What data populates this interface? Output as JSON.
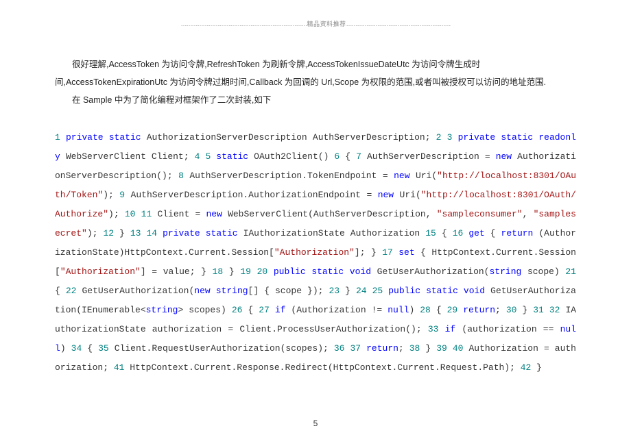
{
  "header": {
    "text": "精品资料推荐"
  },
  "paragraphs": {
    "p1": "很好理解,AccessToken 为访问令牌,RefreshToken 为刷新令牌,AccessTokenIssueDateUtc 为访问令牌生成时间,AccessTokenExpirationUtc 为访问令牌过期时间,Callback 为回调的 Url,Scope 为权限的范围,或者叫被授权可以访问的地址范围.",
    "p2": "在 Sample 中为了简化编程对框架作了二次封装,如下"
  },
  "page_number": "5",
  "code": {
    "n1": "1",
    "kw_private1": "private",
    "kw_static1": "static",
    "pl1": " AuthorizationServerDescription AuthServerDescription; ",
    "n2": "2",
    "n3": "3",
    "kw_private2": "private",
    "kw_static2": "static",
    "kw_readonly": "readonly",
    "pl2": " WebServerClient Client; ",
    "n4": "4",
    "n5": "5",
    "kw_static3": "static",
    "pl3": " OAuth2Client() ",
    "n6": "6",
    "pl4": " { ",
    "n7": "7",
    "pl5": " AuthServerDescription = ",
    "kw_new1": "new",
    "pl6": " AuthorizationServerDescription(); ",
    "n8": "8",
    "pl7": " AuthServerDescription.TokenEndpoint = ",
    "kw_new2": "new",
    "pl8": " Uri(",
    "str1": "\"http://localhost:8301/OAuth/Token\"",
    "pl9": "); ",
    "n9": "9",
    "pl10": " AuthServerDescription.AuthorizationEndpoint = ",
    "kw_new3": "new",
    "pl11": " Uri(",
    "str2": "\"http://localhost:8301/OAuth/Authorize\"",
    "pl12": "); ",
    "n10": "10",
    "n11": "11",
    "pl13": " Client = ",
    "kw_new4": "new",
    "pl14": " WebServerClient(AuthServerDescription, ",
    "str3": "\"sampleconsumer\"",
    "pl15": ", ",
    "str4": "\"samplesecret\"",
    "pl16": "); ",
    "n12": "12",
    "pl17": " } ",
    "n13": "13",
    "n14": "14",
    "kw_private3": "private",
    "kw_static4": "static",
    "pl18": " IAuthorizationState Authorization ",
    "n15": "15",
    "pl19": " { ",
    "n16": "16",
    "kw_get": "get",
    "pl20": " { ",
    "kw_return1": "return",
    "pl21": " (AuthorizationState)HttpContext.Current.Session[",
    "str5": "\"Authorization\"",
    "pl22": "]; } ",
    "n17": "17",
    "kw_set": "set",
    "pl23": " { HttpContext.Current.Session[",
    "str6": "\"Authorization\"",
    "pl24": "] = value; } ",
    "n18": "18",
    "pl25": " } ",
    "n19": "19",
    "n20": "20",
    "kw_public1": "public",
    "kw_static5": "static",
    "kw_void1": "void",
    "pl26": " GetUserAuthorization(",
    "kw_string1": "string",
    "pl27": " scope) ",
    "n21": "21",
    "pl28": " { ",
    "n22": "22",
    "pl29": " GetUserAuthorization(",
    "kw_new5": "new",
    "kw_string2": "string",
    "pl30": "[] { scope }); ",
    "n23": "23",
    "pl31": " } ",
    "n24": "24",
    "n25": "25",
    "kw_public2": "public",
    "kw_static6": "static",
    "kw_void2": "void",
    "pl32": " GetUserAuthorization(IEnumerable<",
    "kw_string3": "string",
    "pl33": "> scopes) ",
    "n26": "26",
    "pl34": " { ",
    "n27": "27",
    "kw_if1": "if",
    "pl35": " (Authorization != ",
    "kw_null1": "null",
    "pl36": ") ",
    "n28": "28",
    "pl37": " { ",
    "n29": "29",
    "kw_return2": "return",
    "pl38": "; ",
    "n30": "30",
    "pl39": " } ",
    "n31": "31",
    "n32": "32",
    "pl40": " IAuthorizationState authorization = Client.ProcessUserAuthorization(); ",
    "n33": "33",
    "kw_if2": "if",
    "pl41": " (authorization == ",
    "kw_null2": "null",
    "pl42": ") ",
    "n34": "34",
    "pl43": " { ",
    "n35": "35",
    "pl44": " Client.RequestUserAuthorization(scopes); ",
    "n36": "36",
    "n37": "37",
    "kw_return3": "return",
    "pl45": "; ",
    "n38": "38",
    "pl46": " } ",
    "n39": "39",
    "n40": "40",
    "pl47": " Authorization = authorization; ",
    "n41": "41",
    "pl48": " HttpContext.Current.Response.Redirect(HttpContext.Current.Request.Path); ",
    "n42": "42",
    "pl49": " }"
  }
}
